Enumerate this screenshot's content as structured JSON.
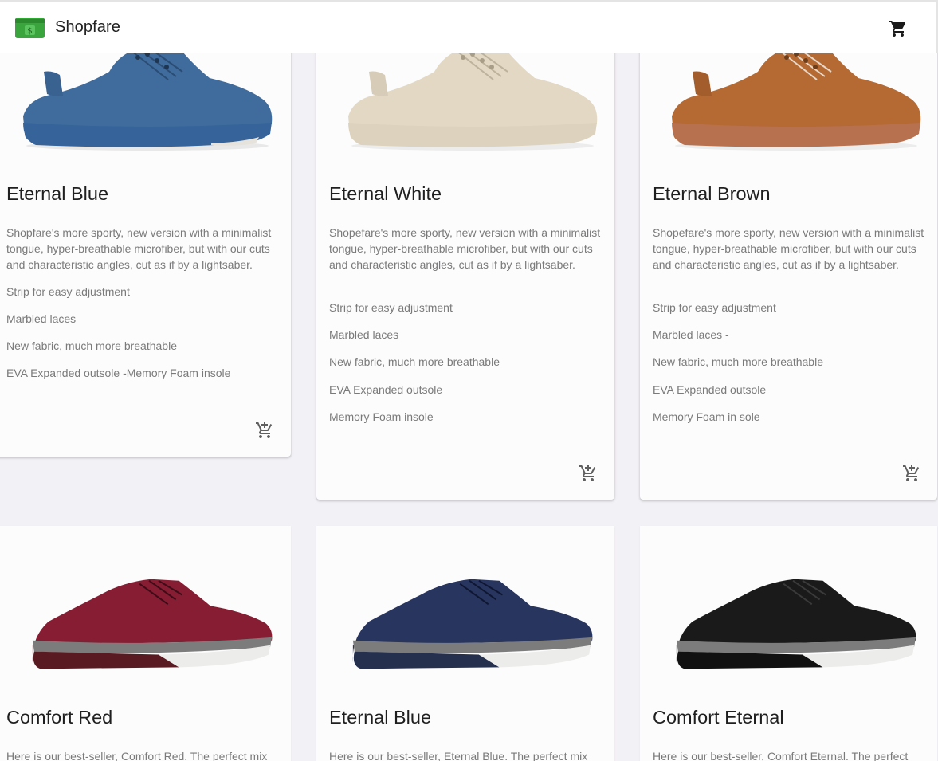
{
  "app": {
    "name": "Shopfare",
    "logo": "green-banknote-card",
    "accent": "#3aa53c"
  },
  "header": {
    "cart_icon": "shopping-cart-icon"
  },
  "products": [
    {
      "title": "Eternal Blue",
      "color": "#3f6c9c",
      "description": "Shopfare's more sporty, new version with a minimalist tongue, hyper-breathable microfiber, but with our cuts and characteristic angles, cut as if by a lightsaber.",
      "features": [
        "Strip for easy adjustment",
        "Marbled laces",
        "New fabric, much more breathable",
        "EVA Expanded outsole  -Memory Foam insole"
      ],
      "action_icon": "add-shopping-cart-icon"
    },
    {
      "title": "Eternal White",
      "color": "#e2d8c4",
      "description": "Shopefare's more sporty, new version with a minimalist tongue, hyper-breathable microfiber, but with our cuts and characteristic angles, cut as if by a lightsaber.",
      "features": [
        "Strip for easy adjustment",
        "Marbled laces",
        "New fabric, much more breathable",
        "EVA Expanded outsole",
        "Memory Foam insole"
      ],
      "action_icon": "add-shopping-cart-icon"
    },
    {
      "title": "Eternal Brown",
      "color": "#b56a34",
      "description": "Shopefare's more sporty, new version with a minimalist tongue, hyper-breathable microfiber, but with our cuts and characteristic angles, cut as if by a lightsaber.",
      "features": [
        "Strip for easy adjustment",
        "Marbled laces  -",
        "New fabric, much more breathable",
        "EVA Expanded outsole",
        "Memory Foam in sole"
      ],
      "action_icon": "add-shopping-cart-icon"
    },
    {
      "title": "Comfort Red",
      "color": "#861d33",
      "description": "Here is our best-seller, Comfort Red. The perfect mix"
    },
    {
      "title": "Eternal Blue",
      "color": "#27355f",
      "description": "Here is our best-seller, Eternal Blue. The perfect mix"
    },
    {
      "title": "Comfort Eternal",
      "color": "#1a1a1a",
      "description": "Here is our best-seller, Comfort Eternal. The perfect"
    }
  ]
}
